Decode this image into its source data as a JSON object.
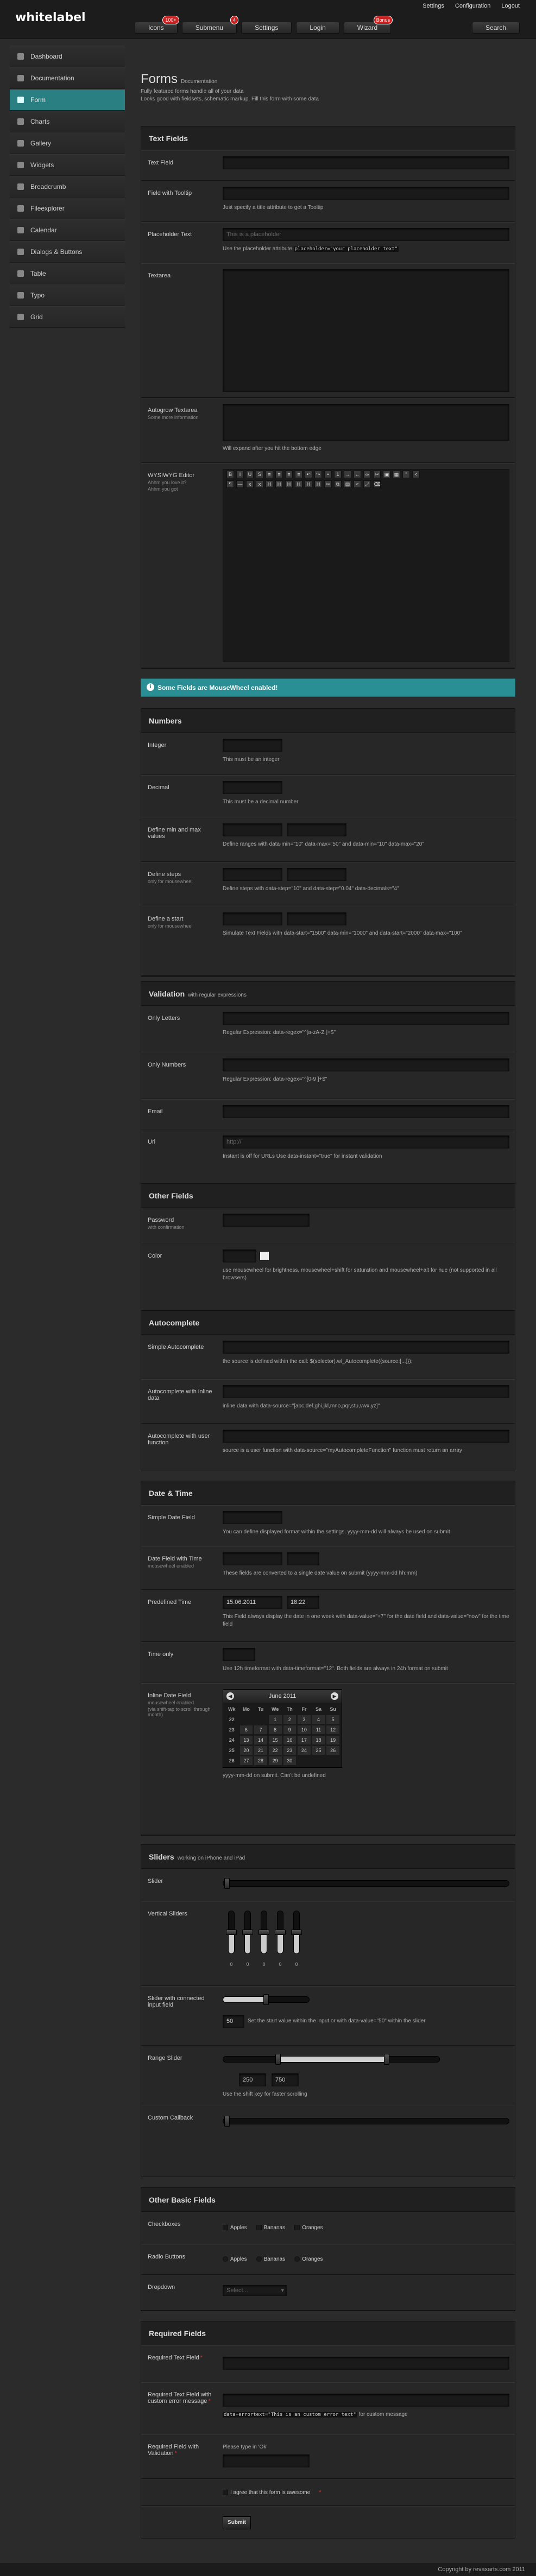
{
  "app": {
    "logo": "whitelabel"
  },
  "toplinks": [
    "Settings",
    "Configuration",
    "Logout"
  ],
  "nav": [
    {
      "label": "Icons",
      "badge": "100+"
    },
    {
      "label": "Submenu",
      "badge": "4"
    },
    {
      "label": "Settings",
      "badge": ""
    },
    {
      "label": "Login",
      "badge": ""
    },
    {
      "label": "Wizard",
      "badge": "Bonus"
    }
  ],
  "search": {
    "label": "Search"
  },
  "sidebar": {
    "items": [
      {
        "label": "Dashboard",
        "icon": "home-icon"
      },
      {
        "label": "Documentation",
        "icon": "book-icon"
      },
      {
        "label": "Form",
        "icon": "form-icon",
        "active": true
      },
      {
        "label": "Charts",
        "icon": "chart-icon"
      },
      {
        "label": "Gallery",
        "icon": "image-icon"
      },
      {
        "label": "Widgets",
        "icon": "widget-icon"
      },
      {
        "label": "Breadcrumb",
        "icon": "breadcrumb-icon"
      },
      {
        "label": "Fileexplorer",
        "icon": "folder-icon"
      },
      {
        "label": "Calendar",
        "icon": "calendar-icon"
      },
      {
        "label": "Dialogs & Buttons",
        "icon": "dialog-icon"
      },
      {
        "label": "Table",
        "icon": "table-icon"
      },
      {
        "label": "Typo",
        "icon": "type-icon"
      },
      {
        "label": "Grid",
        "icon": "grid-icon"
      }
    ]
  },
  "page": {
    "title": "Forms",
    "title_small": "Documentation",
    "desc_1": "Fully featured forms handle all of your data",
    "desc_2": "Looks good with fieldsets, schematic markup. Fill this form with some data"
  },
  "textfields": {
    "title": "Text Fields",
    "textfield_label": "Text Field",
    "tooltip_label": "Field with Tooltip",
    "tooltip_hint": "Just specify a title attribute to get a Tooltip",
    "placeholder_label": "Placeholder Text",
    "placeholder_value": "This is a placeholder",
    "placeholder_hint_pre": "Use the placeholder attribute",
    "placeholder_hint_code": "placeholder=\"your placeholder text\"",
    "textarea_label": "Textarea",
    "autogrow_label": "Autogrow Textarea",
    "autogrow_sub": "Some more information",
    "autogrow_hint": "Will expand after you hit the bottom edge",
    "wysiwyg_label": "WYSIWYG Editor",
    "wysiwyg_sub_1": "Ahhm you love it?",
    "wysiwyg_sub_2": "Ahhm you got"
  },
  "notice": {
    "text": "Some Fields are MouseWheel enabled!"
  },
  "numbers": {
    "title": "Numbers",
    "integer_label": "Integer",
    "integer_hint": "This must be an integer",
    "decimal_label": "Decimal",
    "decimal_hint": "This must be a decimal number",
    "minmax_label": "Define min and max values",
    "minmax_hint": "Define ranges with data-min=\"10\" data-max=\"50\" and data-min=\"10\" data-max=\"20\"",
    "steps_label": "Define steps",
    "steps_sub": "only for mousewheel",
    "steps_hint": "Define steps with data-step=\"10\" and data-step=\"0.04\" data-decimals=\"4\"",
    "start_label": "Define a start",
    "start_sub": "only for mousewheel",
    "start_hint": "Simulate Text Fields with data-start=\"1500\" data-min=\"1000\" and data-start=\"2000\" data-max=\"100\""
  },
  "validation": {
    "title": "Validation",
    "title_small": "with regular expressions",
    "letters_label": "Only Letters",
    "letters_hint": "Regular Expression: data-regex=\"^[a-zA-Z ]+$\"",
    "numbers_label": "Only Numbers",
    "numbers_hint": "Regular Expression: data-regex=\"^[0-9 ]+$\"",
    "email_label": "Email",
    "url_label": "Url",
    "url_value": "http://",
    "url_hint": "Instant is off for URLs Use data-instant=\"true\" for instant validation"
  },
  "other": {
    "title": "Other Fields",
    "password_label": "Password",
    "password_sub": "with confirmation",
    "color_label": "Color",
    "color_hint": "use mousewheel for brightness, mousewheel+shift for saturation and mousewheel+alt for hue (not supported in all browsers)"
  },
  "autocomplete": {
    "title": "Autocomplete",
    "simple_label": "Simple Autocomplete",
    "simple_hint": "the source is defined within the call: $(selector).wl_Autocomplete({source:[...]});",
    "inline_label": "Autocomplete with inline data",
    "inline_hint": "inline data with data-source=\"[abc,def,ghi,jkl,mno,pqr,stu,vwx,yz]\"",
    "func_label": "Autocomplete with user function",
    "func_hint": "source is a user function with data-source=\"myAutocompleteFunction\" function must return an array"
  },
  "datetime": {
    "title": "Date & Time",
    "simple_label": "Simple Date Field",
    "simple_hint": "You can define displayed format within the settings. yyyy-mm-dd will always be used on submit",
    "withtime_label": "Date Field with Time",
    "withtime_sub": "mousewheel enabled",
    "withtime_hint": "These fields are converted to a single date value on submit (yyyy-mm-dd hh:mm)",
    "predefined_label": "Predefined Time",
    "predefined_date": "15.06.2011",
    "predefined_time": "18:22",
    "predefined_hint": "This Field always display the date in one week with data-value=\"+7\" for the date field and data-value=\"now\" for the time field",
    "timeonly_label": "Time only",
    "timeonly_hint": "Use 12h timeformat with data-timeformat=\"12\". Both fields are always in 24h format on submit",
    "inline_label": "Inline Date Field",
    "inline_sub_1": "mousewheel enabled",
    "inline_sub_2": "(via shift-tap to scroll through month)",
    "inline_hint": "yyyy-mm-dd on submit. Can't be undefined",
    "calendar": {
      "month": "June 2011",
      "dows": [
        "Wk",
        "Mo",
        "Tu",
        "We",
        "Th",
        "Fr",
        "Sa",
        "Su"
      ],
      "cells": [
        "22",
        "",
        "",
        "1",
        "2",
        "3",
        "4",
        "5",
        "23",
        "6",
        "7",
        "8",
        "9",
        "10",
        "11",
        "12",
        "24",
        "13",
        "14",
        "15",
        "16",
        "17",
        "18",
        "19",
        "25",
        "20",
        "21",
        "22",
        "23",
        "24",
        "25",
        "26",
        "26",
        "27",
        "28",
        "29",
        "30",
        "",
        "",
        ""
      ]
    }
  },
  "sliders": {
    "title": "Sliders",
    "title_small": "working on iPhone and iPad",
    "slider_label": "Slider",
    "vertical_label": "Vertical Sliders",
    "vertical_values": [
      "0",
      "0",
      "0",
      "0",
      "0"
    ],
    "connected_label": "Slider with connected input field",
    "connected_value": "50",
    "connected_hint": "Set the start value within the input or with data-value=\"50\" within the slider",
    "range_label": "Range Slider",
    "range_min": "250",
    "range_max": "750",
    "range_hint": "Use the shift key for faster scrolling",
    "callback_label": "Custom Callback"
  },
  "basic": {
    "title": "Other Basic Fields",
    "checkboxes_label": "Checkboxes",
    "radio_label": "Radio Buttons",
    "options": [
      "Apples",
      "Bananas",
      "Oranges"
    ],
    "dropdown_label": "Dropdown",
    "dropdown_value": "Select..."
  },
  "required": {
    "title": "Required Fields",
    "text_label": "Required Text Field",
    "custom_label": "Required Text Field with custom error message",
    "custom_hint_code": "data-errortext=\"This is an custom error text\"",
    "custom_hint_post": "for custom message",
    "validation_label": "Required Field with Validation",
    "validation_hint": "Please type in 'Ok'",
    "agree_label": "I agree that this form is awesome",
    "submit": "Submit"
  },
  "footer": {
    "text": "Copyright by revaxarts.com 2011"
  }
}
